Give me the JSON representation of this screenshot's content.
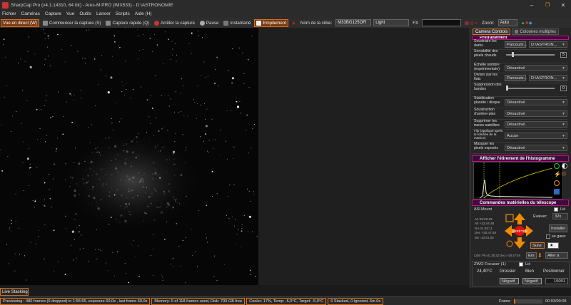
{
  "window": {
    "title": "SharpCap Pro (v4.1.14310, 64 bit) - Ares-M PRO (IMX533) - D:\\ASTRONOMIE"
  },
  "menu": [
    "Fichier",
    "Caméras",
    "Capture",
    "Vue",
    "Outils",
    "Lancer",
    "Scripts",
    "Aide (H)"
  ],
  "toolbar": {
    "live_view": "Vue en direct (W)",
    "start_capture": "Commencer la capture (S)",
    "quick_capture": "Capture rapide (Q)",
    "stop_capture": "Arrêter la capture",
    "pause": "Pause",
    "snapshot": "Instantané",
    "stacking": "Empilement",
    "target_label": "Nom de la cible:",
    "target_value": "M33BG125OFI",
    "filter_value": "Light",
    "fx_label": "FX",
    "zoom_label": "Zoom:",
    "zoom_value": "Auto"
  },
  "right_panel": {
    "tab_camera": "Camera Controls",
    "tab_multi": "Colonnes multiples",
    "section_title": "Prétraitement",
    "rows": [
      {
        "label": "Soustraire les darks",
        "button": "Parcourir...",
        "value": "D:\\ASTRON..."
      },
      {
        "label": "Sensibilité des pixels chauds",
        "value": "5"
      },
      {
        "label": "Échelle sombre (expérimentale)",
        "value": "Désactivé"
      },
      {
        "label": "Diviser par les flats",
        "button": "Parcourir...",
        "value": "D:\\ASTRON..."
      },
      {
        "label": "Suppression des bandes",
        "value": "0"
      },
      {
        "label": "Stabilisation planète / disque",
        "value": "Désactivé"
      },
      {
        "label": "Soustraction d'arrière-plan",
        "value": "Désactivé"
      },
      {
        "label": "Supprimer les traces satellites",
        "value": "Désactivé"
      },
      {
        "label": "Flip (appliqué après le tombée de la matrice)",
        "value": "Aucun"
      },
      {
        "label": "Masquer les pixels exposés",
        "value": "Désactivé"
      }
    ],
    "histogram_title": "Afficher l'étirement de l'histogramme",
    "telescope_title": "Commandes matérielles du télescope",
    "mount_name": "ASI Mount",
    "mount_connected": "Lié",
    "slew_label": "Évaluer:",
    "slew_value": "32x",
    "install_button": "Installer",
    "park_label": "se garer",
    "follow_button": "Suivi",
    "coords": [
      {
        "k": "Az",
        "v": "09:26:29"
      },
      {
        "k": "Alt",
        "v": "+33:44:48"
      },
      {
        "k": "RA",
        "v": "01:35:11"
      },
      {
        "k": "Dec",
        "v": "+30:47:48"
      },
      {
        "k": "SE",
        "v": "-10:51:05"
      }
    ],
    "pier_text": "Côté: Ph=01:35:32 Dec=+30:47:48",
    "stop_button": "Ers",
    "goto_button": "Aller à",
    "focuser_name": "ZWO Focuser (1)",
    "focuser_connected": "Lié",
    "focuser_temp": "24,40°C",
    "coarse_label": "Grossier",
    "fine_label": "Bien",
    "position_label": "Positionner",
    "neg_button_1": "Négatif",
    "neg_button_2": "Négatif",
    "position_value": "15091"
  },
  "bottom": {
    "live_tab": "Live Stacking",
    "status_preview": "Previewing : 480 frames (0 dropped) in 1:55:55, exposure 60,0s , last frame 60,0s",
    "status_memory": "Memory: 5 of 118 frames used, Disk: 793 GB free",
    "status_cooler": "Cooler: 17%, Temp: -5,0°C, Target: -5,0°C",
    "status_stack": "6 Stacked, 0 Ignored, 6m 0s",
    "frame_label": "Frame",
    "frame_progress": 0.06,
    "frame_time": "00:03/00:05"
  },
  "colors": {
    "accent": "#e07010",
    "section_border": "#c01080",
    "section_bg": "#3d0a3d",
    "arrow_orange": "#f08a00",
    "stop_red": "#e01010"
  },
  "icons": [
    "app-icon",
    "minimize-icon",
    "maximize-icon",
    "close-icon",
    "record-icon",
    "pause-icon",
    "camera-icon",
    "stack-icon",
    "arrow-up-icon",
    "arrow-down-icon",
    "arrow-left-icon",
    "arrow-right-icon",
    "stop-icon",
    "star-icon"
  ]
}
